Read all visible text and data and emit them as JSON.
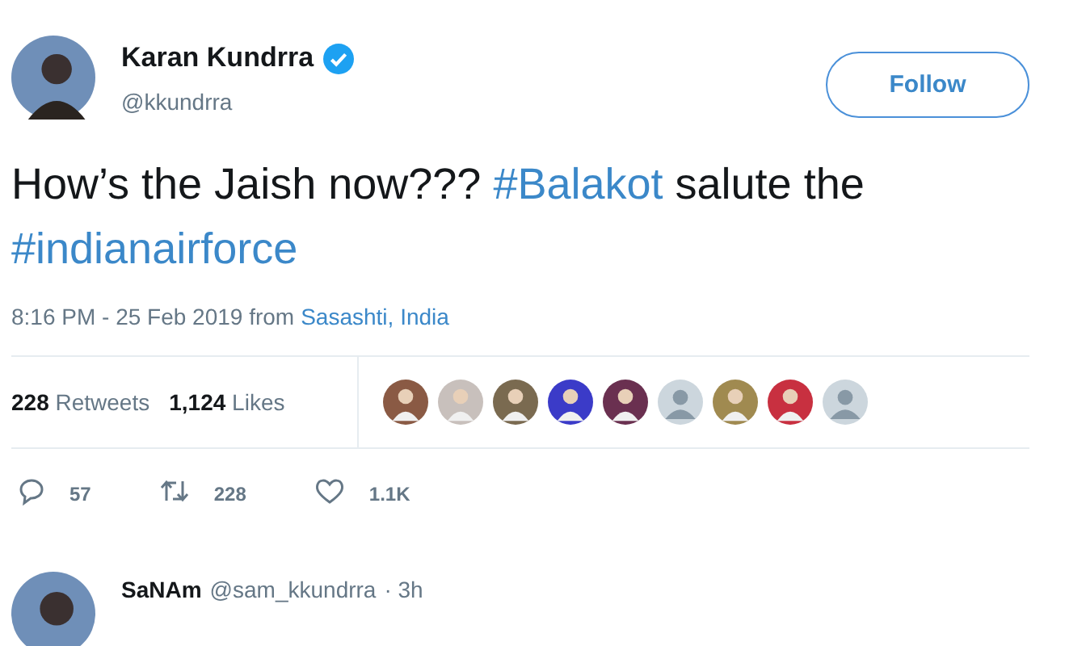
{
  "author": {
    "name": "Karan Kundrra",
    "verified": true,
    "handle": "@kkundrra"
  },
  "follow_button": {
    "label": "Follow"
  },
  "tweet": [
    {
      "kind": "text",
      "text": "How’s the Jaish now??? "
    },
    {
      "kind": "hashtag",
      "text": "#Balakot"
    },
    {
      "kind": "text",
      "text": " salute the "
    },
    {
      "kind": "hashtag",
      "text": "#indianairforce"
    }
  ],
  "timestamp": "8:16 PM - 25 Feb 2019 from",
  "location": "Sasashti, India",
  "stats": [
    {
      "count": "228",
      "label": "Retweets"
    },
    {
      "count": "1,124",
      "label": "Likes"
    }
  ],
  "likers": [
    {
      "kind": "photo",
      "color": "#8a5a44"
    },
    {
      "kind": "photo",
      "color": "#c8c0bc"
    },
    {
      "kind": "photo",
      "color": "#7a6a50"
    },
    {
      "kind": "photo",
      "color": "#3b3bc8"
    },
    {
      "kind": "photo",
      "color": "#6a3050"
    },
    {
      "kind": "default",
      "color": "#ccd6dd"
    },
    {
      "kind": "photo",
      "color": "#a08a50"
    },
    {
      "kind": "photo",
      "color": "#c83040"
    },
    {
      "kind": "default",
      "color": "#ccd6dd"
    }
  ],
  "actions": [
    {
      "kind": "reply",
      "count": "57"
    },
    {
      "kind": "retweet",
      "count": "228"
    },
    {
      "kind": "like",
      "count": "1.1K"
    }
  ],
  "reply": {
    "name": "SaNAm",
    "handle": "@sam_kkundrra",
    "time": "· 3h"
  }
}
